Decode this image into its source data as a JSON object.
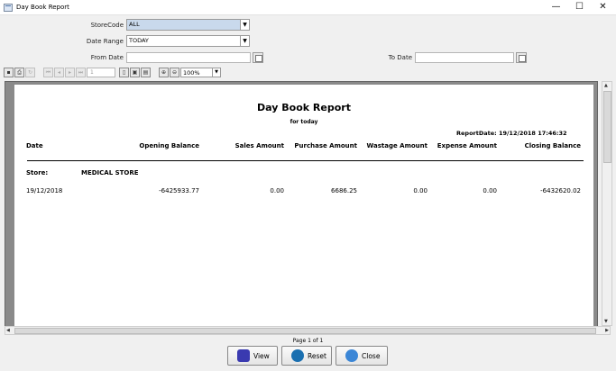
{
  "window": {
    "title": "Day Book Report",
    "minimize": "—",
    "maximize": "☐",
    "close": "✕"
  },
  "filters": {
    "store_code_label": "StoreCode",
    "store_code_value": "ALL",
    "date_range_label": "Date Range",
    "date_range_value": "TODAY",
    "from_date_label": "From Date",
    "from_date_value": "",
    "to_date_label": "To Date",
    "to_date_value": ""
  },
  "toolbar": {
    "page_number": "1",
    "zoom_value": "100%"
  },
  "report": {
    "title": "Day Book Report",
    "subtitle": "for today",
    "report_date": "ReportDate: 19/12/2018 17:46:32",
    "columns": [
      "Date",
      "Opening Balance",
      "Sales Amount",
      "Purchase Amount",
      "Wastage Amount",
      "Expense Amount",
      "Closing Balance"
    ],
    "store_label": "Store:",
    "store_name": "MEDICAL STORE",
    "rows": [
      [
        "19/12/2018",
        "-6425933.77",
        "0.00",
        "6686.25",
        "0.00",
        "0.00",
        "-6432620.02"
      ]
    ]
  },
  "page_info": "Page 1 of 1",
  "buttons": {
    "view": "View",
    "reset": "Reset",
    "close": "Close"
  },
  "colors": {
    "combo_selected": "#c9d9ec",
    "view_icon": "#3a3ab0",
    "reset_icon": "#1a6fb0",
    "close_icon": "#3b86d6"
  }
}
